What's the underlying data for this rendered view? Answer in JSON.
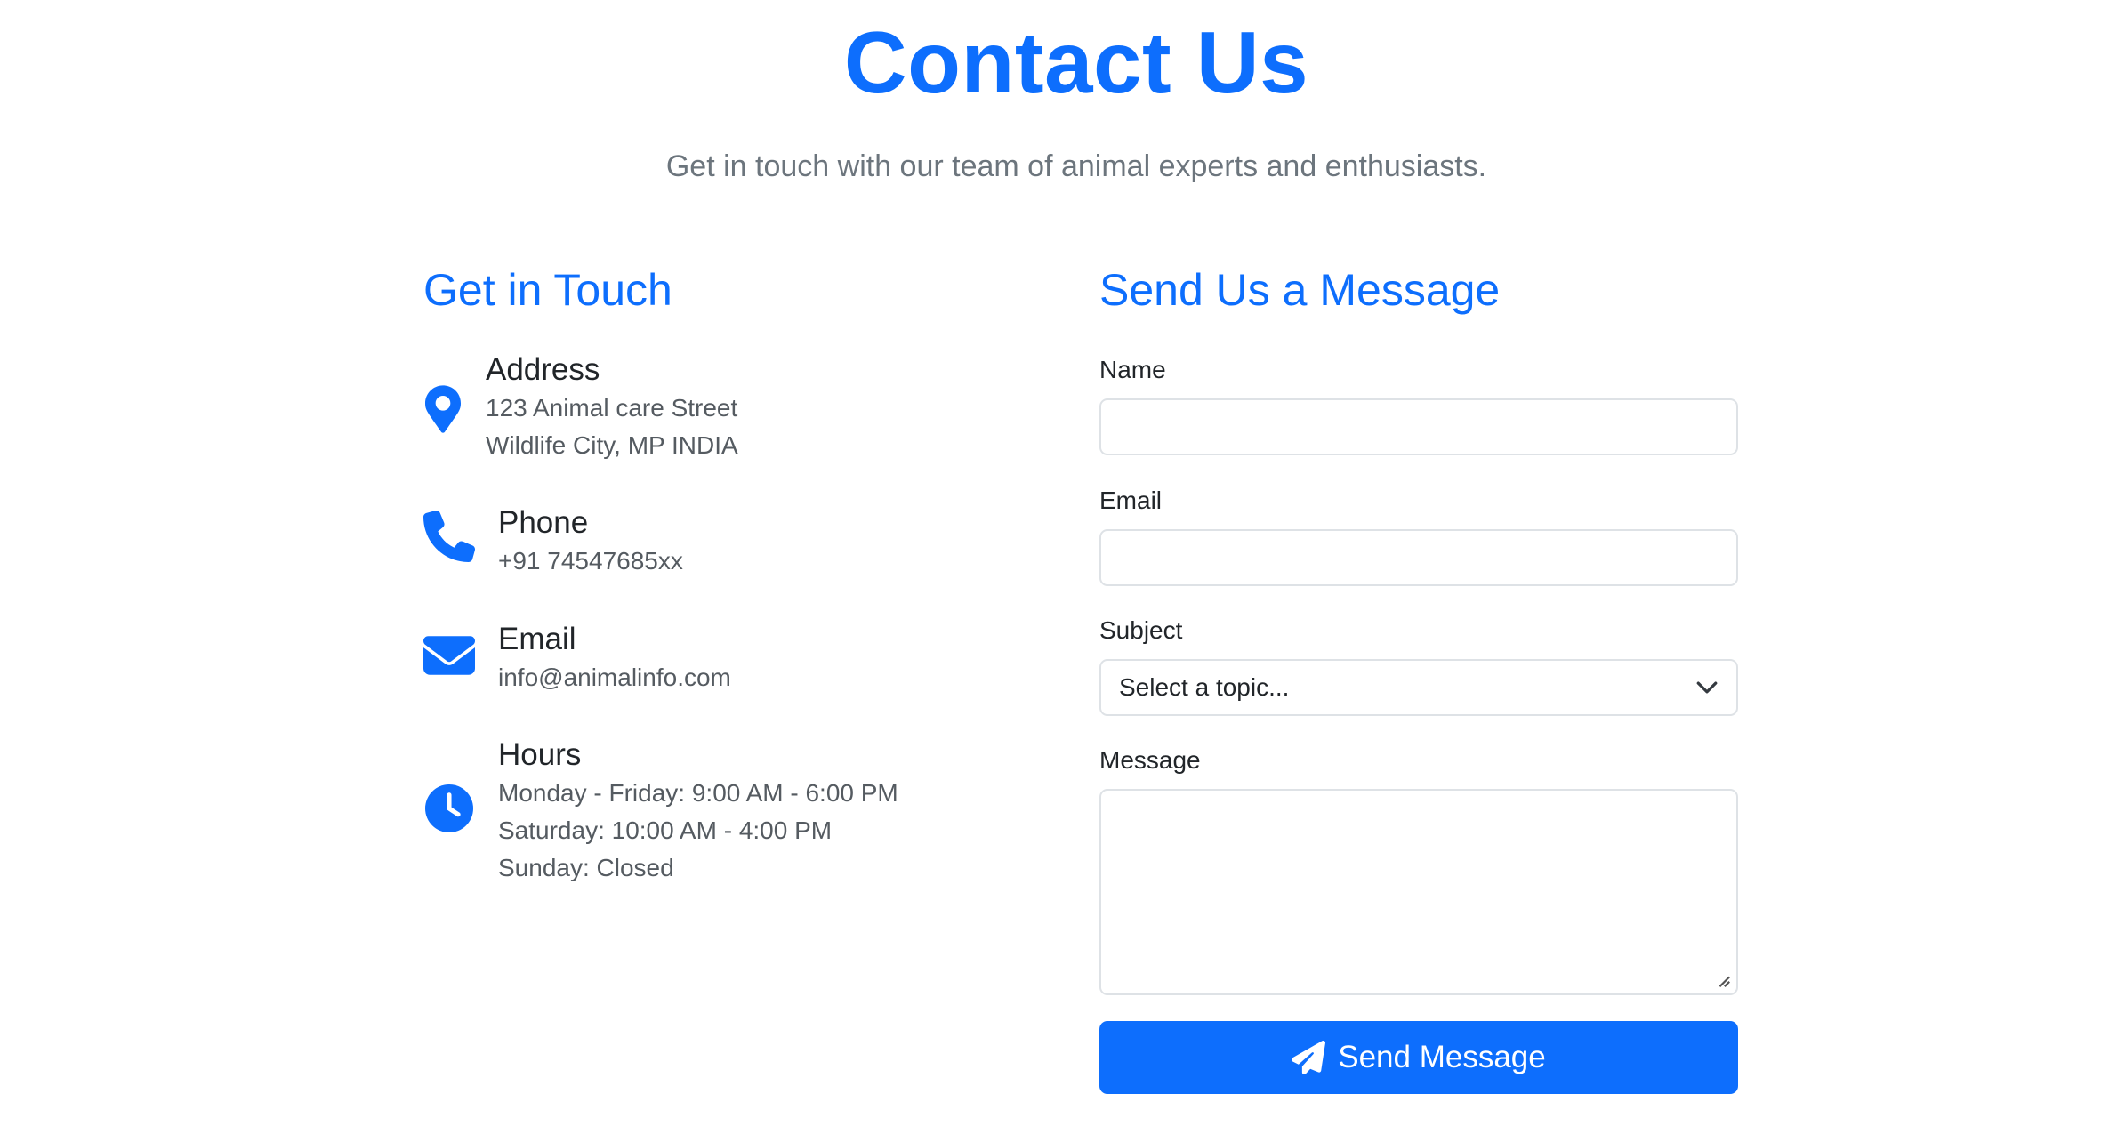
{
  "header": {
    "title": "Contact Us",
    "subtitle": "Get in touch with our team of animal experts and enthusiasts."
  },
  "contact_info": {
    "heading": "Get in Touch",
    "items": [
      {
        "icon": "map-pin-icon",
        "title": "Address",
        "lines": [
          "123 Animal care Street",
          "Wildlife City, MP INDIA"
        ]
      },
      {
        "icon": "phone-icon",
        "title": "Phone",
        "lines": [
          "+91 74547685xx"
        ]
      },
      {
        "icon": "envelope-icon",
        "title": "Email",
        "lines": [
          "info@animalinfo.com"
        ]
      },
      {
        "icon": "clock-icon",
        "title": "Hours",
        "lines": [
          "Monday - Friday: 9:00 AM - 6:00 PM",
          "Saturday: 10:00 AM - 4:00 PM",
          "Sunday: Closed"
        ]
      }
    ]
  },
  "form": {
    "heading": "Send Us a Message",
    "name_label": "Name",
    "name_value": "",
    "email_label": "Email",
    "email_value": "",
    "subject_label": "Subject",
    "subject_selected": "Select a topic...",
    "message_label": "Message",
    "message_value": "",
    "submit_label": "Send Message"
  },
  "colors": {
    "accent": "#0d6efd",
    "muted_text": "#6c757d",
    "border": "#dee2e6"
  }
}
